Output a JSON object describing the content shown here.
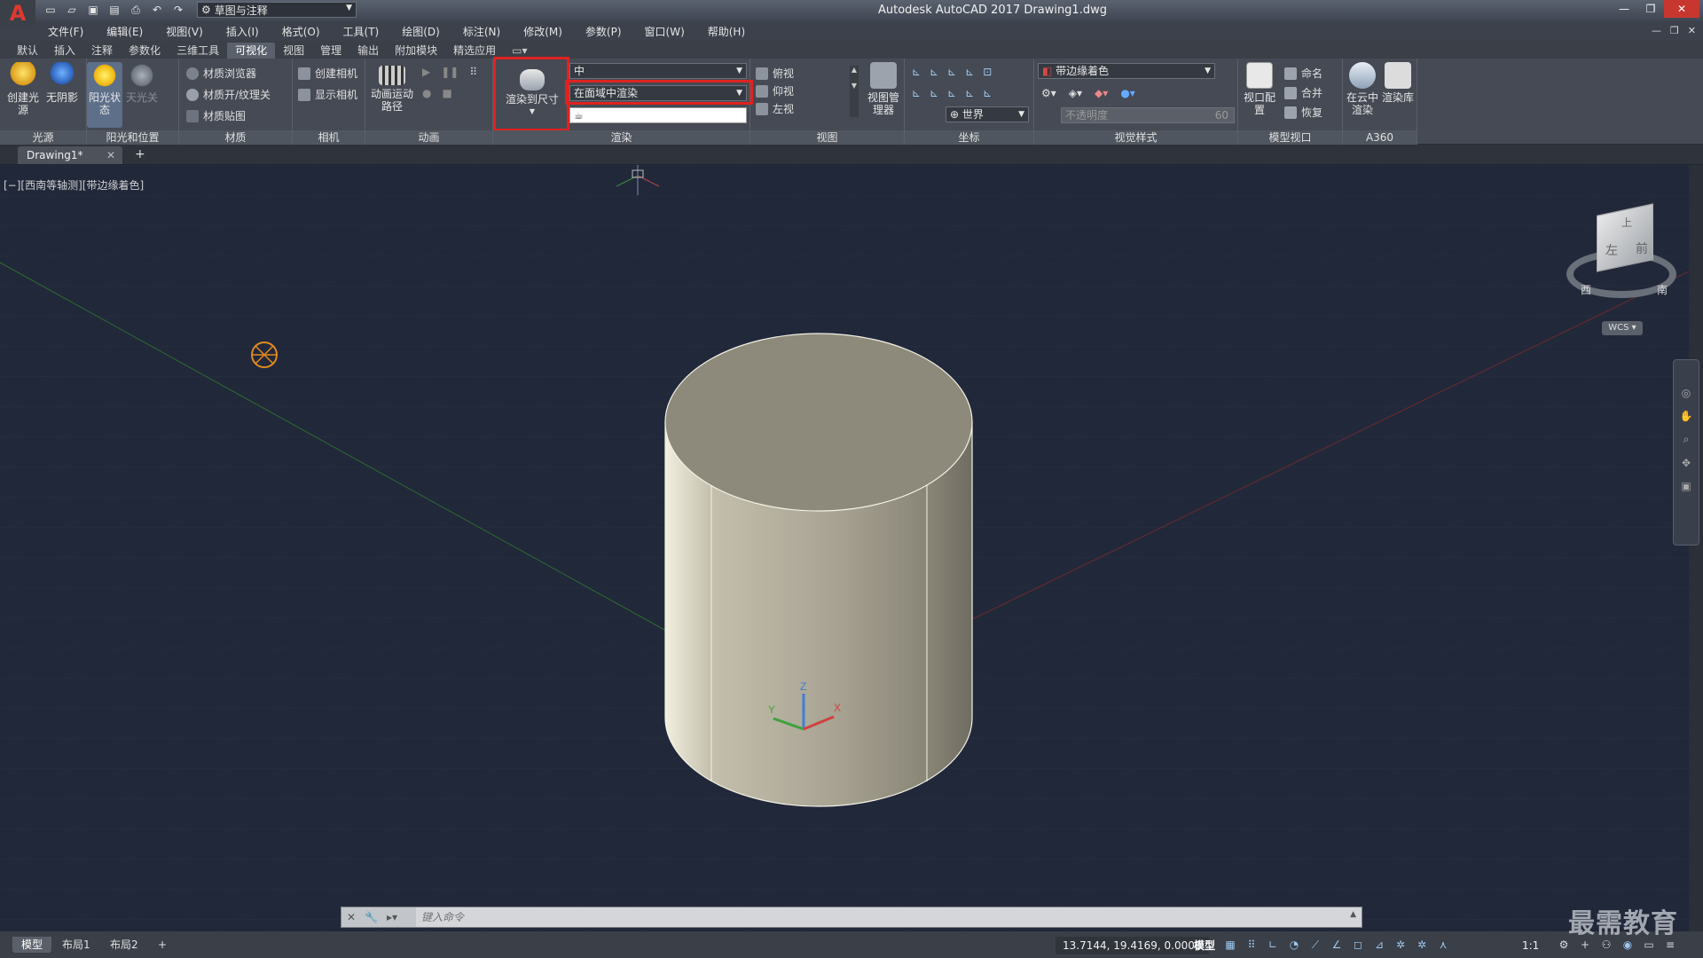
{
  "window": {
    "title": "Autodesk AutoCAD 2017    Drawing1.dwg",
    "workspace": "草图与注释"
  },
  "menu": [
    "文件(F)",
    "编辑(E)",
    "视图(V)",
    "插入(I)",
    "格式(O)",
    "工具(T)",
    "绘图(D)",
    "标注(N)",
    "修改(M)",
    "参数(P)",
    "窗口(W)",
    "帮助(H)"
  ],
  "ribbon_tabs": [
    "默认",
    "插入",
    "注释",
    "参数化",
    "三维工具",
    "可视化",
    "视图",
    "管理",
    "输出",
    "附加模块",
    "精选应用"
  ],
  "active_ribbon_tab": "可视化",
  "panels": {
    "lights": {
      "title": "光源",
      "create_light": "创建光源",
      "no_shadow": "无阴影",
      "sun_status": "阳光状态",
      "sky_off": "天光关"
    },
    "sun_location": {
      "title": "阳光和位置"
    },
    "materials": {
      "title": "材质",
      "browser": "材质浏览器",
      "mat_onoff": "材质开/纹理关",
      "mapping": "材质贴图"
    },
    "camera": {
      "title": "相机",
      "create": "创建相机",
      "show": "显示相机"
    },
    "animation": {
      "title": "动画",
      "motion_path": "动画运动路径"
    },
    "render": {
      "title": "渲染",
      "render_to_size": "渲染到尺寸",
      "quality": "中",
      "render_in": "在面域中渲染"
    },
    "views": {
      "title": "视图",
      "top": "俯视",
      "bottom": "仰视",
      "left": "左视",
      "manager": "视图管理器"
    },
    "coordinates": {
      "title": "坐标",
      "ucs": "世界"
    },
    "visual_styles": {
      "title": "视觉样式",
      "style": "带边缘着色",
      "opacity_placeholder": "不透明度",
      "opacity_value": "60"
    },
    "model_viewports": {
      "title": "模型视口",
      "config": "视口配置",
      "name": "命名",
      "merge": "合并",
      "restore": "恢复"
    },
    "a360": {
      "title": "A360",
      "cloud_render": "在云中渲染",
      "gallery": "渲染库"
    }
  },
  "file_tab": "Drawing1*",
  "viewport": {
    "label": "[−][西南等轴测][带边缘着色]",
    "viewcube": {
      "top": "上",
      "left": "左",
      "front": "前",
      "south": "南",
      "west": "西"
    },
    "wcs": "WCS"
  },
  "command": {
    "placeholder": "键入命令"
  },
  "status": {
    "layouts": [
      "模型",
      "布局1",
      "布局2"
    ],
    "coords": "13.7144, 19.4169, 0.0000",
    "model": "模型",
    "scale": "1:1"
  },
  "watermark": "最需教育",
  "colors": {
    "viewport_bg": "#21283a",
    "highlight": "#e0221f",
    "cylinder": "#a8a393"
  }
}
